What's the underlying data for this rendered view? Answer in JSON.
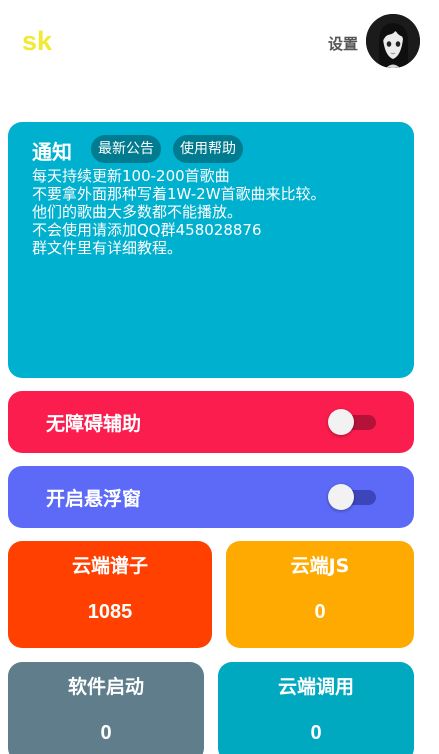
{
  "header": {
    "app_name": "sk",
    "settings_label": "设置",
    "avatar_icon": "avatar-illustration-icon"
  },
  "notice": {
    "title": "通知",
    "chips": [
      "最新公告",
      "使用帮助"
    ],
    "lines": [
      "每天持续更新100-200首歌曲",
      "不要拿外面那种写着1W-2W首歌曲来比较。",
      "他们的歌曲大多数都不能播放。",
      "不会使用请添加QQ群458028876",
      "群文件里有详细教程。"
    ],
    "color": "#00b0cf"
  },
  "toggles": [
    {
      "label": "无障碍辅助",
      "on": false,
      "color": "#fb1d4d"
    },
    {
      "label": "开启悬浮窗",
      "on": false,
      "color": "#5c6af7"
    }
  ],
  "stats": [
    {
      "label": "云端谱子",
      "value": "1085",
      "color": "#ff4000"
    },
    {
      "label": "云端JS",
      "value": "0",
      "color": "#ffaa00"
    },
    {
      "label": "软件启动",
      "value": "0",
      "color": "#5f7d8b"
    },
    {
      "label": "云端调用",
      "value": "0",
      "color": "#00a8c0"
    }
  ]
}
